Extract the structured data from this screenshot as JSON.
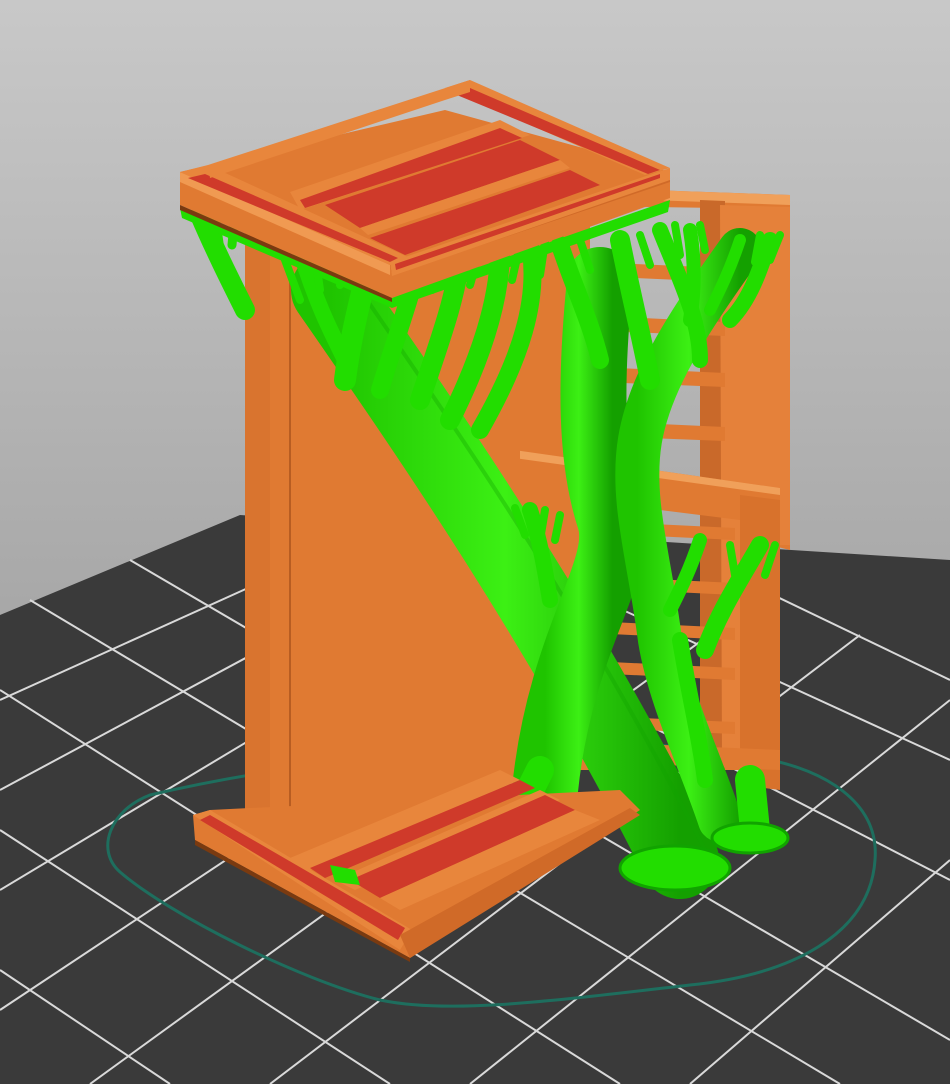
{
  "viewport": {
    "view": "3d-slice-preview",
    "background_color": "#a9a9a9",
    "bed_color": "#3a3a3a",
    "grid_color": "#d9d9d9",
    "skirt_color": "#1e6e5e"
  },
  "model": {
    "wall_color": "#e07a32",
    "wall_dark_color": "#c9692a",
    "infill_color": "#cf3a2a",
    "support_color": "#22dd00",
    "support_dark_color": "#11a300",
    "support_type": "tree"
  }
}
